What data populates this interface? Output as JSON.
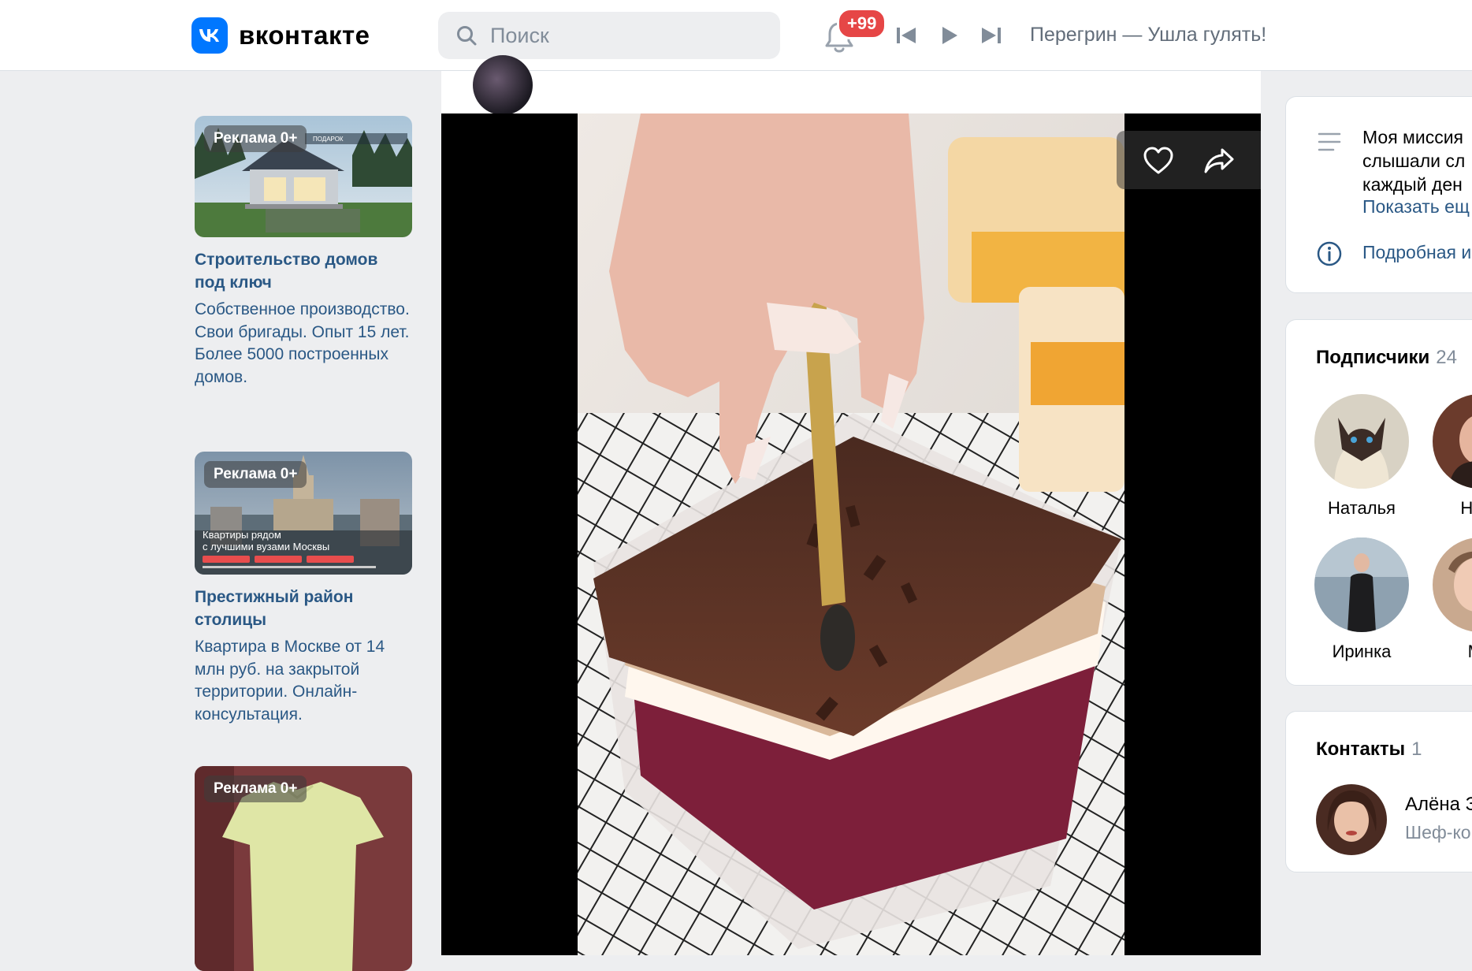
{
  "header": {
    "logo_text": "вконтакте",
    "search_placeholder": "Поиск",
    "notifications_badge": "+99",
    "now_playing": "Перегрин — Ушла гулять!"
  },
  "ads": [
    {
      "badge": "Реклама 0+",
      "title": "Строительство домов под ключ",
      "description": "Собственное производство. Свои бригады. Опыт 15 лет. Более 5000 построенных домов."
    },
    {
      "badge": "Реклама 0+",
      "title": "Престижный район столицы",
      "description": "Квартира в Москве от 14 млн руб. на закрытой территории. Онлайн-консультация.",
      "image_caption": "Квартиры рядом с лучшими вузами Москвы"
    },
    {
      "badge": "Реклама 0+"
    }
  ],
  "profile_info": {
    "about_lines": [
      "Моя миссия",
      "слышали сл",
      "каждый ден"
    ],
    "show_more": "Показать ещ",
    "details": "Подробная и"
  },
  "subscribers": {
    "title": "Подписчики",
    "count": "24",
    "people": [
      {
        "name": "Наталья"
      },
      {
        "name": "Наст"
      },
      {
        "name": "Иринка"
      },
      {
        "name": "Ма"
      }
    ]
  },
  "contacts": {
    "title": "Контакты",
    "count": "1",
    "person": {
      "name": "Алёна З",
      "role": "Шеф-ко"
    }
  },
  "colors": {
    "brand": "#0077ff",
    "link": "#2a5885",
    "badge": "#e64646",
    "page_bg": "#edeef0"
  }
}
